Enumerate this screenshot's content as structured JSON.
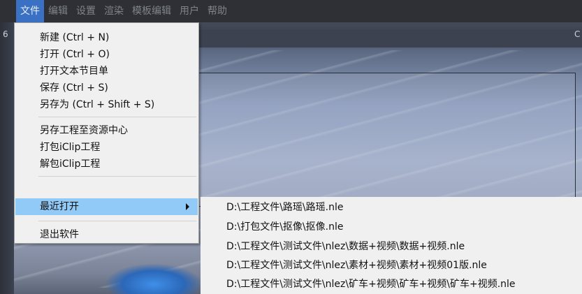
{
  "menubar": {
    "items": [
      "文件",
      "编辑",
      "设置",
      "渲染",
      "模板编辑",
      "用户",
      "帮助"
    ],
    "active_index": 0
  },
  "background": {
    "left_digit": "6",
    "right_letter": "C"
  },
  "file_menu": {
    "items": [
      {
        "label": "新建 (Ctrl + N)"
      },
      {
        "label": "打开 (Ctrl + O)"
      },
      {
        "label": "打开文本节目单"
      },
      {
        "label": "保存 (Ctrl + S)"
      },
      {
        "label": "另存为 (Ctrl + Shift + S)"
      },
      {
        "label": "另存工程至资源中心"
      },
      {
        "label": "打包iClip工程"
      },
      {
        "label": "解包iClip工程"
      },
      {
        "label": "最近打开",
        "highlighted": true,
        "has_submenu": true
      },
      {
        "label": "退出软件"
      }
    ]
  },
  "recent_submenu": {
    "items": [
      "D:\\工程文件\\路瑶\\路瑶.nle",
      "D:\\打包文件\\抠像\\抠像.nle",
      "D:\\工程文件\\测试文件\\nlez\\数据+视频\\数据+视频.nle",
      "D:\\工程文件\\测试文件\\nlez\\素材+视频\\素材+视频01版.nle",
      "D:\\工程文件\\测试文件\\nlez\\矿车+视频\\矿车+视频\\矿车+视频.nle"
    ]
  },
  "colors": {
    "menubar_bg": "#2e3035",
    "menubar_active": "#3b71c4",
    "menu_bg": "#f0f0f0",
    "menu_highlight": "#91c9f7"
  }
}
